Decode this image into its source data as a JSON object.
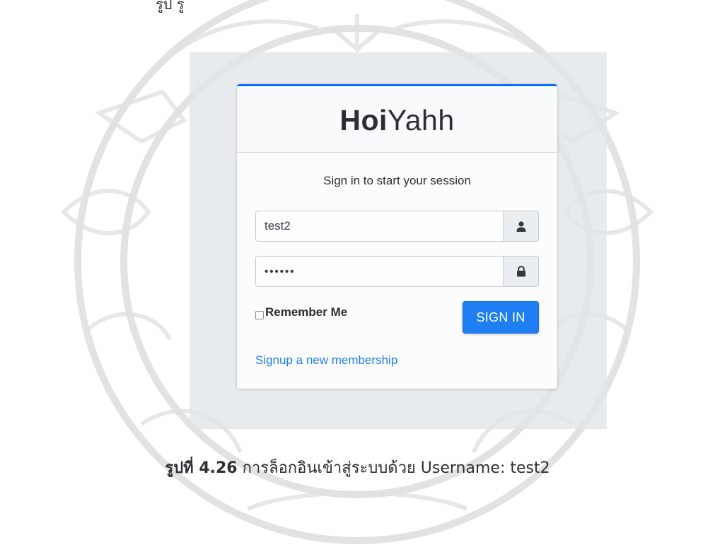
{
  "page": {
    "top_cropped_text": "รูป                               รู"
  },
  "login": {
    "logo_bold": "Hoi",
    "logo_regular": "Yahh",
    "message": "Sign in to start your session",
    "username_value": "test2",
    "password_value": "••••••",
    "remember_label": "Remember Me",
    "sign_in_label": "SIGN IN",
    "signup_link": "Signup a new membership"
  },
  "caption": {
    "figure_label": "รูปที่ 4.26",
    "text": " การล็อกอินเข้าสู่ระบบด้วย Username: test2"
  },
  "colors": {
    "accent": "#1f7ff2",
    "top_border": "#0d6efd",
    "panel_bg": "#e2e5e8"
  },
  "icons": {
    "username_addon": "user-icon",
    "password_addon": "lock-icon",
    "watermark": "university-seal"
  }
}
